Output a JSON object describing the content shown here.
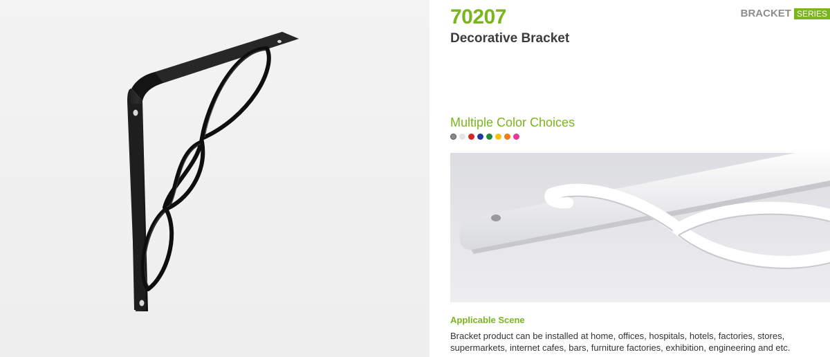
{
  "product": {
    "model": "70207",
    "name": "Decorative Bracket"
  },
  "series": {
    "word": "BRACKET",
    "badge": "SERIES"
  },
  "colors": {
    "heading": "Multiple Color Choices",
    "swatches": [
      {
        "name": "grey",
        "hex": "#8a8a8a"
      },
      {
        "name": "white",
        "hex": "#e4e4e4"
      },
      {
        "name": "red",
        "hex": "#d8261c"
      },
      {
        "name": "blue",
        "hex": "#1f3a9c"
      },
      {
        "name": "green",
        "hex": "#1e8a3a"
      },
      {
        "name": "yellow",
        "hex": "#f2c40f"
      },
      {
        "name": "orange",
        "hex": "#ee7d1a"
      },
      {
        "name": "pink",
        "hex": "#e63a9a"
      }
    ]
  },
  "scene": {
    "title": "Applicable Scene",
    "description": "Bracket product can be installed at home, offices, hospitals, hotels, factories, stores, supermarkets, internet cafes, bars, furniture factories, exhibition, engineering and etc."
  },
  "theme": {
    "accent": "#7ab51d",
    "text_dark": "#3c3c3c",
    "text_grey": "#8d8d8d"
  }
}
